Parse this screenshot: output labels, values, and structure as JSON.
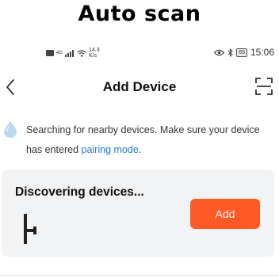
{
  "caption": "Auto scan",
  "status_bar": {
    "left_icons": [
      "sim-card-icon",
      "network-icon",
      "signal-icon",
      "wifi-icon"
    ],
    "net_label": "4G",
    "speed_value": "14.3",
    "speed_unit": "K/s",
    "right_icons": [
      "eye-icon",
      "bluetooth-icon",
      "battery-icon"
    ],
    "battery_level": "65",
    "time": "15:06"
  },
  "header": {
    "title": "Add Device",
    "back_icon": "chevron-left-icon",
    "scan_icon": "scan-icon"
  },
  "info": {
    "icon": "water-drop-icon",
    "text_before": "Searching for nearby devices. Make sure your device has entered ",
    "link_text": "pairing mode",
    "text_after": "."
  },
  "discovery": {
    "title": "Discovering devices...",
    "add_label": "Add",
    "device_icon": "device-icon",
    "accent_color": "#ff5a26"
  }
}
